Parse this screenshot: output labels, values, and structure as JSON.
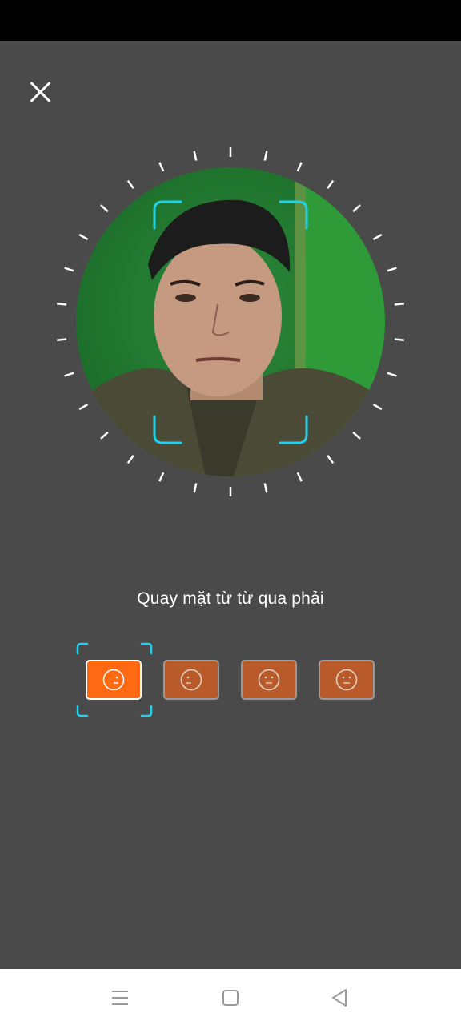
{
  "header": {
    "close_icon": "close-icon"
  },
  "camera": {
    "frame_icon": "face-frame-icon",
    "frame_color": "#19d3f0"
  },
  "instruction": {
    "text": "Quay mặt từ từ qua phải"
  },
  "steps": [
    {
      "icon": "face-turn-right-icon",
      "state": "active"
    },
    {
      "icon": "face-turn-left-icon",
      "state": "pending"
    },
    {
      "icon": "face-neutral-icon",
      "state": "pending"
    },
    {
      "icon": "face-neutral-icon",
      "state": "pending"
    }
  ],
  "nav_bar": {
    "menu_icon": "menu-icon",
    "home_icon": "home-icon",
    "back_icon": "back-icon"
  },
  "colors": {
    "background": "#4a4a4a",
    "accent": "#ff6a13",
    "frame": "#19d3f0"
  }
}
